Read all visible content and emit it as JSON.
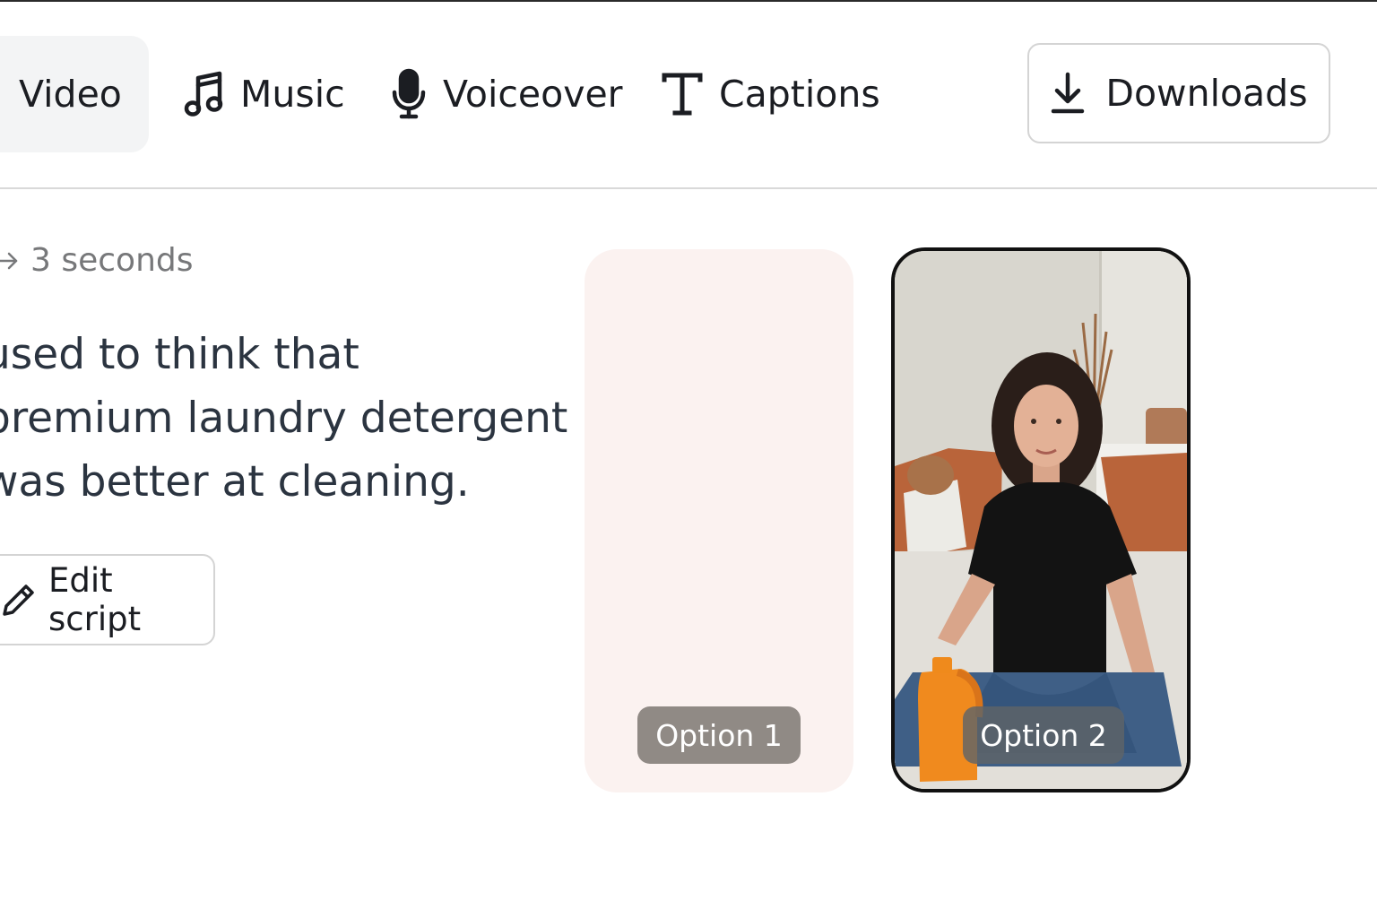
{
  "toolbar": {
    "tabs": [
      {
        "label": "Video",
        "icon": "video",
        "active": true
      },
      {
        "label": "Music",
        "icon": "music-note-icon",
        "active": false
      },
      {
        "label": "Voiceover",
        "icon": "microphone-icon",
        "active": false
      },
      {
        "label": "Captions",
        "icon": "text-t-icon",
        "active": false
      }
    ],
    "downloads_label": "Downloads",
    "downloads_icon": "download-icon"
  },
  "scene": {
    "duration": "3 seconds",
    "duration_icon": "arrow-right-icon",
    "script_lines": [
      "used to think that",
      "premium laundry detergent",
      "was better at cleaning."
    ],
    "edit_label": "Edit script",
    "edit_icon": "pencil-icon"
  },
  "options": [
    {
      "label": "Option 1",
      "selected": false
    },
    {
      "label": "Option 2",
      "selected": true
    }
  ],
  "colors": {
    "accent_border": "#111111",
    "option1_bg": "#fbf2f0",
    "muted_text": "#77787a",
    "script_text": "#2b3440"
  }
}
